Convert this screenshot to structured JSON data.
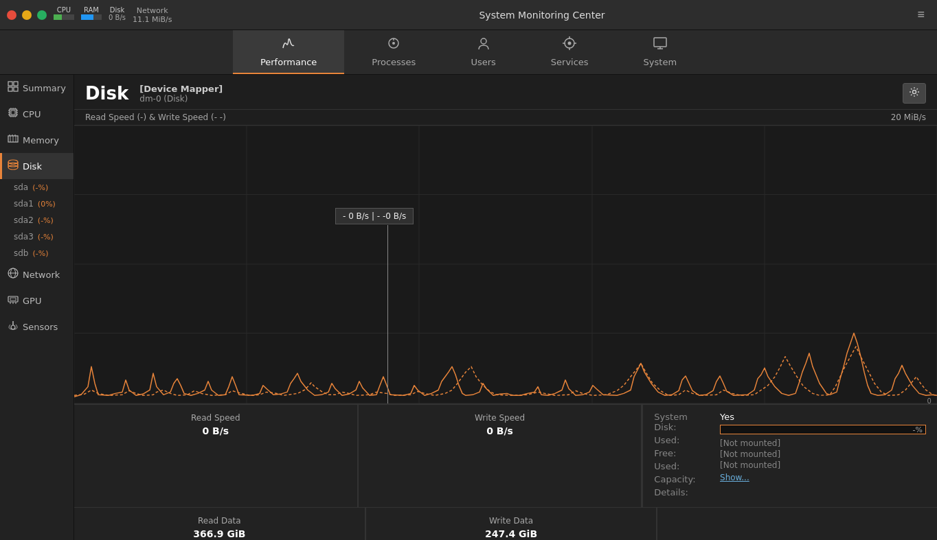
{
  "titlebar": {
    "title": "System Monitoring Center",
    "close_btn": "×",
    "min_btn": "−",
    "max_btn": "+",
    "menu_btn": "≡",
    "cpu_label": "CPU",
    "ram_label": "RAM",
    "disk_label": "Disk",
    "network_label": "Network",
    "network_value": "11.1 MiB/s",
    "disk_value": "0 B/s"
  },
  "tabs": [
    {
      "id": "performance",
      "label": "Performance",
      "icon": "⟳",
      "active": true
    },
    {
      "id": "processes",
      "label": "Processes",
      "icon": "⚙",
      "active": false
    },
    {
      "id": "users",
      "label": "Users",
      "icon": "🖱",
      "active": false
    },
    {
      "id": "services",
      "label": "Services",
      "icon": "⚙",
      "active": false
    },
    {
      "id": "system",
      "label": "System",
      "icon": "🖥",
      "active": false
    }
  ],
  "sidebar": {
    "items": [
      {
        "id": "summary",
        "label": "Summary",
        "icon": "◈",
        "active": false
      },
      {
        "id": "cpu",
        "label": "CPU",
        "icon": "▦",
        "active": false
      },
      {
        "id": "memory",
        "label": "Memory",
        "icon": "▤",
        "active": false
      },
      {
        "id": "disk",
        "label": "Disk",
        "icon": "⬡",
        "active": true
      },
      {
        "id": "network",
        "label": "Network",
        "icon": "◎",
        "active": false
      },
      {
        "id": "gpu",
        "label": "GPU",
        "icon": "▣",
        "active": false
      },
      {
        "id": "sensors",
        "label": "Sensors",
        "icon": "◉",
        "active": false
      }
    ],
    "disk_items": [
      {
        "id": "sda",
        "label": "sda",
        "badge": "(-%)"
      },
      {
        "id": "sda1",
        "label": "sda1",
        "badge": "(0%)"
      },
      {
        "id": "sda2",
        "label": "sda2",
        "badge": "(-%)"
      },
      {
        "id": "sda3",
        "label": "sda3",
        "badge": "(-%)"
      },
      {
        "id": "sdb",
        "label": "sdb",
        "badge": "(-%)"
      }
    ]
  },
  "disk": {
    "title": "Disk",
    "device_label": "[Device Mapper]",
    "device_sub": "dm-0 (Disk)",
    "graph_label": "Read Speed (-) & Write Speed (-  -)",
    "graph_max": "20 MiB/s",
    "graph_min": "0",
    "tooltip_text": "- 0 B/s  |  - -0 B/s",
    "stats": [
      {
        "label": "Read Speed",
        "value": "0 B/s"
      },
      {
        "label": "Write Speed",
        "value": "0 B/s"
      }
    ],
    "stats2": [
      {
        "label": "Read Data",
        "value": "366.9 GiB"
      },
      {
        "label": "Write Data",
        "value": "247.4 GiB"
      }
    ]
  },
  "system_info": {
    "system_disk_label": "System Disk:",
    "used_label": "Used:",
    "free_label": "Free:",
    "used2_label": "Used:",
    "capacity_label": "Capacity:",
    "details_label": "Details:",
    "yes_label": "Yes",
    "pct_label": "-%",
    "not_mounted_1": "[Not mounted]",
    "not_mounted_2": "[Not mounted]",
    "not_mounted_3": "[Not mounted]",
    "show_label": "Show..."
  }
}
